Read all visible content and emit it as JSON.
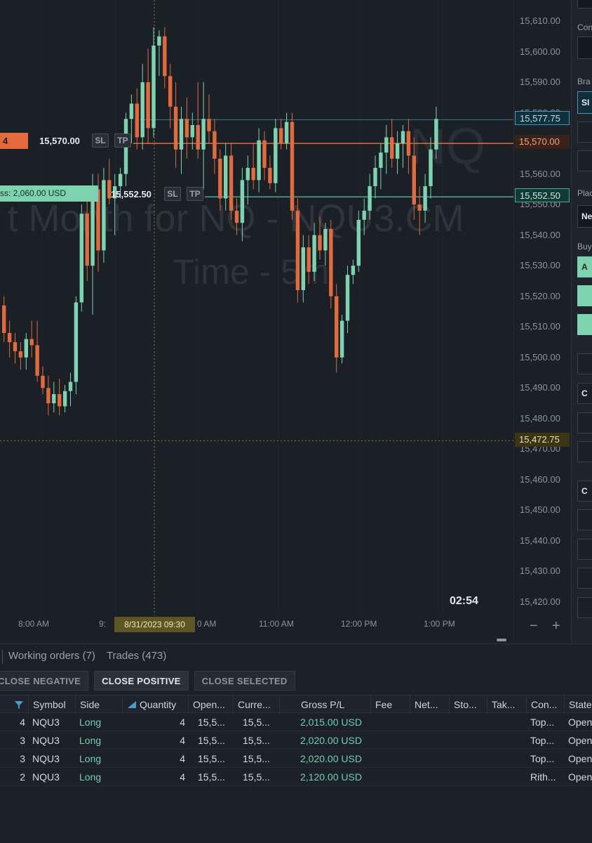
{
  "chart": {
    "watermark_line1": "t Month for NQ - NQU3.CM",
    "watermark_line2": "Time - 5m",
    "watermark_symbol": "NQ",
    "order_tag": {
      "qty": "4",
      "price": "15,570.00",
      "sl": "SL",
      "tp": "TP"
    },
    "pl_tag": {
      "text": "ss: 2,060.00 USD",
      "price": "15,552.50",
      "sl": "SL",
      "tp": "TP"
    },
    "countdown": "02:54",
    "crosshair_date": "8/31/2023 09:30",
    "colors": {
      "up": "#7dd3b0",
      "down": "#e26a3c",
      "background": "#1b1f26"
    }
  },
  "chart_data": {
    "type": "candlestick",
    "title": "",
    "ylim": [
      15415,
      15615
    ],
    "y_ticks": [
      "15,610.00",
      "15,600.00",
      "15,590.00",
      "15,580.00",
      "15,570.00",
      "15,560.00",
      "15,550.00",
      "15,540.00",
      "15,530.00",
      "15,520.00",
      "15,510.00",
      "15,500.00",
      "15,490.00",
      "15,480.00",
      "15,470.00",
      "15,460.00",
      "15,450.00",
      "15,440.00",
      "15,430.00",
      "15,420.00"
    ],
    "x_ticks": [
      "8:00 AM",
      "9:",
      "0 AM",
      "11:00 AM",
      "12:00 PM",
      "1:00 PM"
    ],
    "price_lines": [
      {
        "label": "15,577.75",
        "value": 15577.75,
        "color": "#4a96b0"
      },
      {
        "label": "15,570.00",
        "value": 15570.0,
        "color": "#e26a3c"
      },
      {
        "label": "15,552.50",
        "value": 15552.5,
        "color": "#4ea892"
      },
      {
        "label": "15,472.75",
        "value": 15472.75,
        "color": "#c8b430"
      }
    ],
    "candles": [
      {
        "o": 15517,
        "h": 15520,
        "l": 15505,
        "c": 15508
      },
      {
        "o": 15508,
        "h": 15512,
        "l": 15500,
        "c": 15505
      },
      {
        "o": 15505,
        "h": 15508,
        "l": 15498,
        "c": 15502
      },
      {
        "o": 15502,
        "h": 15505,
        "l": 15496,
        "c": 15500
      },
      {
        "o": 15500,
        "h": 15508,
        "l": 15496,
        "c": 15506
      },
      {
        "o": 15506,
        "h": 15512,
        "l": 15500,
        "c": 15504
      },
      {
        "o": 15504,
        "h": 15512,
        "l": 15492,
        "c": 15494
      },
      {
        "o": 15494,
        "h": 15497,
        "l": 15488,
        "c": 15490
      },
      {
        "o": 15490,
        "h": 15494,
        "l": 15481,
        "c": 15485
      },
      {
        "o": 15485,
        "h": 15492,
        "l": 15482,
        "c": 15488
      },
      {
        "o": 15488,
        "h": 15493,
        "l": 15481,
        "c": 15484
      },
      {
        "o": 15484,
        "h": 15491,
        "l": 15482,
        "c": 15489
      },
      {
        "o": 15489,
        "h": 15495,
        "l": 15484,
        "c": 15492
      },
      {
        "o": 15492,
        "h": 15520,
        "l": 15488,
        "c": 15518
      },
      {
        "o": 15518,
        "h": 15550,
        "l": 15515,
        "c": 15547
      },
      {
        "o": 15547,
        "h": 15552,
        "l": 15525,
        "c": 15530
      },
      {
        "o": 15530,
        "h": 15560,
        "l": 15514,
        "c": 15555
      },
      {
        "o": 15555,
        "h": 15560,
        "l": 15528,
        "c": 15535
      },
      {
        "o": 15535,
        "h": 15562,
        "l": 15531,
        "c": 15558
      },
      {
        "o": 15558,
        "h": 15565,
        "l": 15550,
        "c": 15552
      },
      {
        "o": 15552,
        "h": 15560,
        "l": 15540,
        "c": 15556
      },
      {
        "o": 15556,
        "h": 15562,
        "l": 15552,
        "c": 15560
      },
      {
        "o": 15560,
        "h": 15580,
        "l": 15556,
        "c": 15578
      },
      {
        "o": 15578,
        "h": 15586,
        "l": 15570,
        "c": 15583
      },
      {
        "o": 15583,
        "h": 15588,
        "l": 15568,
        "c": 15572
      },
      {
        "o": 15572,
        "h": 15596,
        "l": 15568,
        "c": 15590
      },
      {
        "o": 15590,
        "h": 15601,
        "l": 15570,
        "c": 15575
      },
      {
        "o": 15575,
        "h": 15608,
        "l": 15572,
        "c": 15602
      },
      {
        "o": 15602,
        "h": 15607,
        "l": 15592,
        "c": 15605
      },
      {
        "o": 15605,
        "h": 15608,
        "l": 15588,
        "c": 15592
      },
      {
        "o": 15592,
        "h": 15596,
        "l": 15575,
        "c": 15582
      },
      {
        "o": 15582,
        "h": 15590,
        "l": 15562,
        "c": 15568
      },
      {
        "o": 15568,
        "h": 15582,
        "l": 15560,
        "c": 15578
      },
      {
        "o": 15578,
        "h": 15585,
        "l": 15565,
        "c": 15572
      },
      {
        "o": 15572,
        "h": 15580,
        "l": 15568,
        "c": 15576
      },
      {
        "o": 15576,
        "h": 15590,
        "l": 15565,
        "c": 15568
      },
      {
        "o": 15568,
        "h": 15590,
        "l": 15555,
        "c": 15578
      },
      {
        "o": 15578,
        "h": 15586,
        "l": 15570,
        "c": 15574
      },
      {
        "o": 15574,
        "h": 15578,
        "l": 15560,
        "c": 15565
      },
      {
        "o": 15565,
        "h": 15568,
        "l": 15548,
        "c": 15552
      },
      {
        "o": 15552,
        "h": 15570,
        "l": 15548,
        "c": 15566
      },
      {
        "o": 15566,
        "h": 15570,
        "l": 15545,
        "c": 15548
      },
      {
        "o": 15548,
        "h": 15552,
        "l": 15540,
        "c": 15544
      },
      {
        "o": 15544,
        "h": 15562,
        "l": 15538,
        "c": 15558
      },
      {
        "o": 15558,
        "h": 15566,
        "l": 15550,
        "c": 15562
      },
      {
        "o": 15562,
        "h": 15570,
        "l": 15555,
        "c": 15558
      },
      {
        "o": 15558,
        "h": 15575,
        "l": 15554,
        "c": 15571
      },
      {
        "o": 15571,
        "h": 15574,
        "l": 15558,
        "c": 15562
      },
      {
        "o": 15562,
        "h": 15566,
        "l": 15555,
        "c": 15557
      },
      {
        "o": 15557,
        "h": 15578,
        "l": 15554,
        "c": 15575
      },
      {
        "o": 15575,
        "h": 15578,
        "l": 15568,
        "c": 15570
      },
      {
        "o": 15570,
        "h": 15580,
        "l": 15568,
        "c": 15577
      },
      {
        "o": 15577,
        "h": 15580,
        "l": 15545,
        "c": 15548
      },
      {
        "o": 15548,
        "h": 15552,
        "l": 15518,
        "c": 15522
      },
      {
        "o": 15522,
        "h": 15540,
        "l": 15518,
        "c": 15536
      },
      {
        "o": 15536,
        "h": 15540,
        "l": 15524,
        "c": 15528
      },
      {
        "o": 15528,
        "h": 15544,
        "l": 15525,
        "c": 15540
      },
      {
        "o": 15540,
        "h": 15546,
        "l": 15532,
        "c": 15535
      },
      {
        "o": 15535,
        "h": 15544,
        "l": 15530,
        "c": 15542
      },
      {
        "o": 15542,
        "h": 15545,
        "l": 15516,
        "c": 15520
      },
      {
        "o": 15520,
        "h": 15524,
        "l": 15495,
        "c": 15500
      },
      {
        "o": 15500,
        "h": 15514,
        "l": 15498,
        "c": 15512
      },
      {
        "o": 15512,
        "h": 15530,
        "l": 15508,
        "c": 15527
      },
      {
        "o": 15527,
        "h": 15532,
        "l": 15524,
        "c": 15530
      },
      {
        "o": 15530,
        "h": 15548,
        "l": 15528,
        "c": 15545
      },
      {
        "o": 15545,
        "h": 15552,
        "l": 15540,
        "c": 15548
      },
      {
        "o": 15548,
        "h": 15560,
        "l": 15545,
        "c": 15556
      },
      {
        "o": 15556,
        "h": 15566,
        "l": 15552,
        "c": 15562
      },
      {
        "o": 15562,
        "h": 15570,
        "l": 15555,
        "c": 15567
      },
      {
        "o": 15567,
        "h": 15576,
        "l": 15560,
        "c": 15572
      },
      {
        "o": 15572,
        "h": 15578,
        "l": 15562,
        "c": 15565
      },
      {
        "o": 15565,
        "h": 15574,
        "l": 15560,
        "c": 15570
      },
      {
        "o": 15570,
        "h": 15576,
        "l": 15562,
        "c": 15574
      },
      {
        "o": 15574,
        "h": 15578,
        "l": 15560,
        "c": 15566
      },
      {
        "o": 15566,
        "h": 15572,
        "l": 15545,
        "c": 15550
      },
      {
        "o": 15550,
        "h": 15556,
        "l": 15540,
        "c": 15548
      },
      {
        "o": 15548,
        "h": 15560,
        "l": 15544,
        "c": 15556
      },
      {
        "o": 15556,
        "h": 15572,
        "l": 15552,
        "c": 15568
      },
      {
        "o": 15568,
        "h": 15582,
        "l": 15565,
        "c": 15578
      }
    ]
  },
  "right_panel": {
    "labels": [
      "Con",
      "Bra",
      "Plac",
      "Buy"
    ],
    "box_texts": [
      "SI",
      "Ne",
      "A",
      "C",
      "C"
    ]
  },
  "bottom": {
    "tabs": [
      "Working orders (7)",
      "Trades (473)"
    ],
    "actions": [
      "CLOSE NEGATIVE",
      "CLOSE POSITIVE",
      "CLOSE SELECTED"
    ],
    "columns": [
      "Symbol",
      "Side",
      "Quantity",
      "Open...",
      "Curre...",
      "Gross P/L",
      "Fee",
      "Net...",
      "Sto...",
      "Tak...",
      "Con...",
      "State"
    ],
    "rows": [
      {
        "id": "4",
        "symbol": "NQU3",
        "side": "Long",
        "qty": "4",
        "open": "15,5...",
        "curr": "15,5...",
        "gross": "2,015.00 USD",
        "con": "Top...",
        "state": "Open"
      },
      {
        "id": "3",
        "symbol": "NQU3",
        "side": "Long",
        "qty": "4",
        "open": "15,5...",
        "curr": "15,5...",
        "gross": "2,020.00 USD",
        "con": "Top...",
        "state": "Open"
      },
      {
        "id": "3",
        "symbol": "NQU3",
        "side": "Long",
        "qty": "4",
        "open": "15,5...",
        "curr": "15,5...",
        "gross": "2,020.00 USD",
        "con": "Top...",
        "state": "Open"
      },
      {
        "id": "2",
        "symbol": "NQU3",
        "side": "Long",
        "qty": "4",
        "open": "15,5...",
        "curr": "15,5...",
        "gross": "2,120.00 USD",
        "con": "Rith...",
        "state": "Open"
      }
    ]
  }
}
